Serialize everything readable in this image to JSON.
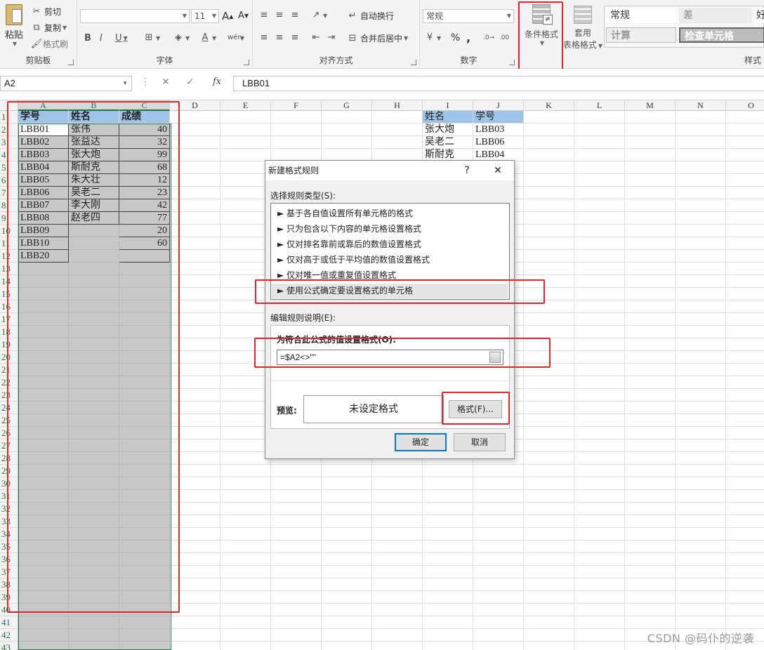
{
  "ribbon": {
    "clipboard": {
      "paste": "粘贴",
      "cut": "剪切",
      "copy": "复制",
      "format_painter": "格式刷",
      "group": "剪贴板"
    },
    "font": {
      "font_size": "11",
      "bold": "B",
      "italic": "I",
      "underline": "U",
      "grow": "A",
      "shrink": "A",
      "group": "字体"
    },
    "alignment": {
      "wrap": "自动换行",
      "merge": "合并后居中",
      "group": "对齐方式"
    },
    "number": {
      "format": "常规",
      "percent": "%",
      "comma": ",",
      "group": "数字"
    },
    "styles": {
      "conditional": "条件格式",
      "table_line1": "套用",
      "table_line2": "表格格式",
      "cell_normal": "常规",
      "cell_bad": "差",
      "cell_good": "好",
      "cell_calc": "计算",
      "cell_check": "检查单元格",
      "group": "样式"
    }
  },
  "formula_bar": {
    "name_box": "A2",
    "fx": "fx",
    "value": "LBB01"
  },
  "grid": {
    "columns": [
      "A",
      "B",
      "C",
      "D",
      "E",
      "F",
      "G",
      "H",
      "I",
      "J",
      "K",
      "L",
      "M",
      "N",
      "O"
    ],
    "rows": [
      "1",
      "2",
      "3",
      "4",
      "5",
      "6",
      "7",
      "8",
      "9",
      "10",
      "11",
      "12",
      "13",
      "14",
      "15",
      "16",
      "17",
      "18",
      "19",
      "20",
      "21",
      "22",
      "23",
      "24",
      "25",
      "26",
      "27",
      "28",
      "29",
      "30",
      "31",
      "32",
      "33",
      "34",
      "35",
      "36",
      "37",
      "38",
      "39",
      "40",
      "41",
      "42",
      "43"
    ],
    "table_header": [
      "学号",
      "姓名",
      "成绩"
    ],
    "table_rows": [
      [
        "LBB01",
        "张伟",
        "40"
      ],
      [
        "LBB02",
        "张益达",
        "32"
      ],
      [
        "LBB03",
        "张大炮",
        "99"
      ],
      [
        "LBB04",
        "斯耐克",
        "68"
      ],
      [
        "LBB05",
        "朱大壮",
        "12"
      ],
      [
        "LBB06",
        "吴老二",
        "23"
      ],
      [
        "LBB07",
        "李大刚",
        "42"
      ],
      [
        "LBB08",
        "赵老四",
        "77"
      ],
      [
        "LBB09",
        "",
        "20"
      ],
      [
        "LBB10",
        "",
        "60"
      ],
      [
        "LBB20",
        "",
        ""
      ]
    ],
    "side_header": [
      "姓名",
      "学号"
    ],
    "side_rows": [
      [
        "张大炮",
        "LBB03"
      ],
      [
        "吴老二",
        "LBB06"
      ],
      [
        "斯耐克",
        "LBB04"
      ]
    ]
  },
  "dialog": {
    "title": "新建格式规则",
    "help": "?",
    "close": "✕",
    "select_type_label": "选择规则类型(S):",
    "rule_types": [
      "► 基于各自值设置所有单元格的格式",
      "► 只为包含以下内容的单元格设置格式",
      "► 仅对排名靠前或靠后的数值设置格式",
      "► 仅对高于或低于平均值的数值设置格式",
      "► 仅对唯一值或重复值设置格式",
      "► 使用公式确定要设置格式的单元格"
    ],
    "edit_label": "编辑规则说明(E):",
    "formula_label": "为符合此公式的值设置格式(O):",
    "formula": "=$A2<>\"\"",
    "preview_label": "预览:",
    "preview_text": "未设定格式",
    "format_button": "格式(F)...",
    "ok": "确定",
    "cancel": "取消"
  },
  "watermark": "CSDN @码仆的逆袭",
  "colors": {
    "highlight_red": "#e8232a",
    "header_blue": "#9dc3e6",
    "excel_green": "#217346",
    "fill_gray": "#c8c8c8"
  }
}
